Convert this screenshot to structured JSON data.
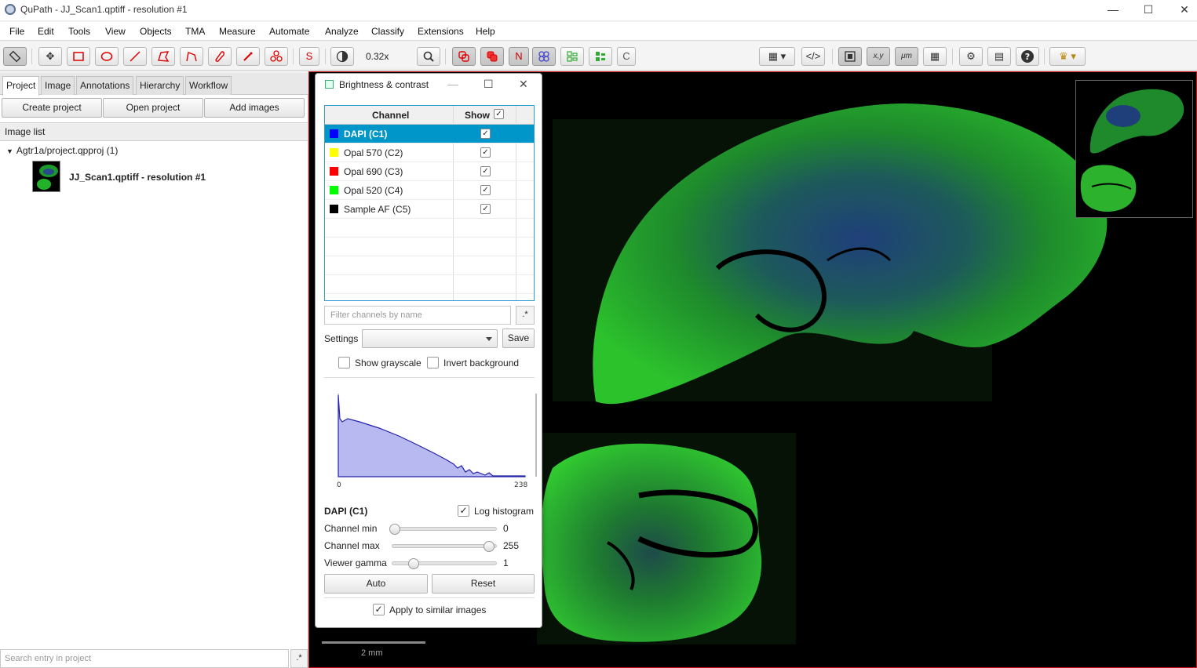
{
  "window": {
    "title": "QuPath - JJ_Scan1.qptiff - resolution #1",
    "minimize": "—",
    "maximize": "☐",
    "close": "✕"
  },
  "menu": [
    "File",
    "Edit",
    "Tools",
    "View",
    "Objects",
    "TMA",
    "Measure",
    "Automate",
    "Analyze",
    "Classify",
    "Extensions",
    "Help"
  ],
  "toolbar": {
    "zoom": "0.32x",
    "text_buttons": {
      "s": "S",
      "n": "N",
      "c": "C"
    },
    "icons": [
      "measure-icon",
      "move-icon",
      "rectangle-icon",
      "ellipse-icon",
      "line-icon",
      "polygon-icon",
      "polyline-icon",
      "brush-icon",
      "wand-icon",
      "points-icon",
      "selection-mode-icon",
      "brightness-contrast-icon",
      "zoom-to-fit-icon",
      "show-annotations-icon",
      "fill-annotations-icon",
      "show-names-icon",
      "show-tma-grid-icon",
      "show-detections-icon",
      "fill-detections-icon",
      "show-connections-icon",
      "opacity-slider",
      "grid-dropdown-icon",
      "script-editor-icon",
      "overview-icon",
      "location-icon",
      "scalebar-icon",
      "pixel-classifier-grid-icon",
      "preferences-icon",
      "log-icon",
      "help-icon",
      "extension-dropdown-icon"
    ]
  },
  "left_panel": {
    "tabs": [
      "Project",
      "Image",
      "Annotations",
      "Hierarchy",
      "Workflow"
    ],
    "active_tab": "Project",
    "buttons": {
      "create": "Create project",
      "open": "Open project",
      "add": "Add images"
    },
    "image_list_label": "Image list",
    "project_node": "Agtr1a/project.qpproj (1)",
    "entry": "JJ_Scan1.qptiff - resolution #1",
    "search_placeholder": "Search entry in project",
    "regex_label": ".*"
  },
  "dialog": {
    "title": "Brightness & contrast",
    "columns": {
      "channel": "Channel",
      "show": "Show",
      "show_check": "✓"
    },
    "channels": [
      {
        "name": "DAPI (C1)",
        "color": "#0000ff",
        "show": "✓",
        "selected": true
      },
      {
        "name": "Opal 570 (C2)",
        "color": "#ffff00",
        "show": "✓",
        "selected": false
      },
      {
        "name": "Opal 690 (C3)",
        "color": "#ff0000",
        "show": "✓",
        "selected": false
      },
      {
        "name": "Opal 520 (C4)",
        "color": "#00ff00",
        "show": "✓",
        "selected": false
      },
      {
        "name": "Sample AF (C5)",
        "color": "#000000",
        "show": "✓",
        "selected": false
      }
    ],
    "filter_placeholder": "Filter channels by name",
    "filter_regex": ".*",
    "settings_label": "Settings",
    "save": "Save",
    "show_grayscale": "Show grayscale",
    "invert_background": "Invert background",
    "histogram": {
      "min_label": "0",
      "max_label": "238"
    },
    "current_channel": "DAPI (C1)",
    "log_histogram": "Log histogram",
    "log_check": "✓",
    "channel_min_label": "Channel min",
    "channel_min_value": "0",
    "channel_max_label": "Channel max",
    "channel_max_value": "255",
    "gamma_label": "Viewer gamma",
    "gamma_value": "1",
    "slider_levels": {
      "channel_min": 0,
      "channel_max": 1.0,
      "gamma": 0.2
    },
    "auto": "Auto",
    "reset": "Reset",
    "apply_similar": "Apply to similar images",
    "apply_check": "✓"
  },
  "viewer": {
    "scale_label": "2 mm"
  },
  "colors": {
    "accent": "#0096c9",
    "tissue": "#1fb51f",
    "viewer_border": "#cc1111"
  }
}
